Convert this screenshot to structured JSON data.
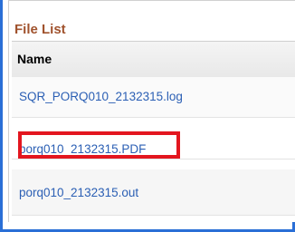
{
  "section": {
    "title": "File List"
  },
  "table": {
    "header": "Name",
    "rows": [
      {
        "name": "SQR_PORQ010_2132315.log"
      },
      {
        "name": "porq010_2132315.PDF"
      },
      {
        "name": "porq010_2132315.out"
      }
    ]
  },
  "colors": {
    "frame_border": "#2a6fd6",
    "title": "#a0522d",
    "link": "#2b5fb4",
    "highlight": "#e3161f"
  }
}
